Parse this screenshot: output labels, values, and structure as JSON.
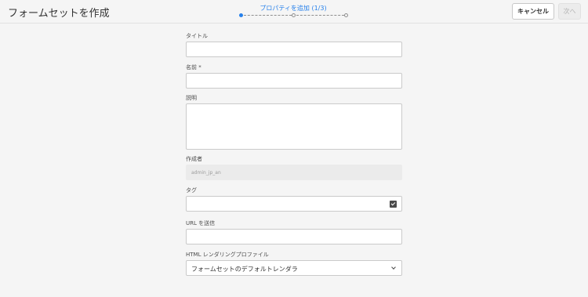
{
  "header": {
    "title": "フォームセットを作成",
    "step_label": "プロパティを追加 (1/3)",
    "cancel_label": "キャンセル",
    "next_label": "次へ"
  },
  "form": {
    "title_label": "タイトル",
    "title_value": "",
    "name_label": "名前 *",
    "name_value": "",
    "description_label": "説明",
    "description_value": "",
    "author_label": "作成者",
    "author_value": "admin_jp_an",
    "tags_label": "タグ",
    "tags_value": "",
    "submit_url_label": "URL を送信",
    "submit_url_value": "",
    "render_profile_label": "HTML レンダリングプロファイル",
    "render_profile_value": "フォームセットのデフォルトレンダラ"
  },
  "colors": {
    "accent": "#2680eb",
    "background": "#f5f5f5"
  },
  "icons": {
    "tag_picker": "check-icon",
    "select": "chevron-down-icon"
  }
}
